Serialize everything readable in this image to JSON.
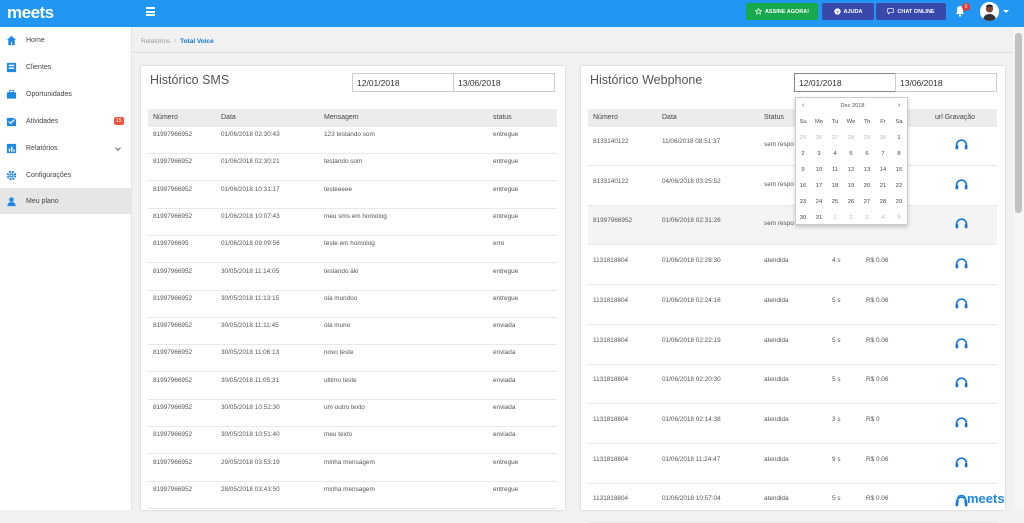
{
  "brand": {
    "logo": "meets",
    "watermark": "meets",
    "accent": "#2196f3"
  },
  "topbar": {
    "assine": "ASSINE AGORA!",
    "ajuda": "AJUDA",
    "chat": "CHAT ONLINE",
    "notif_count": "0"
  },
  "sidebar": {
    "items": [
      {
        "label": "Home",
        "icon": "home-icon"
      },
      {
        "label": "Clientes",
        "icon": "clients-icon"
      },
      {
        "label": "Oportunidades",
        "icon": "briefcase-icon"
      },
      {
        "label": "Atividades",
        "icon": "check-icon",
        "badge": "15"
      },
      {
        "label": "Relatórios",
        "icon": "chart-icon"
      },
      {
        "label": "Configurações",
        "icon": "gear-icon"
      },
      {
        "label": "Meu plano",
        "icon": "user-icon"
      }
    ]
  },
  "breadcrumb": {
    "parent": "Relatórios",
    "sep": "/",
    "current": "Total Voice"
  },
  "sms": {
    "title": "Histórico SMS",
    "date_from": "12/01/2018",
    "date_to": "13/06/2018",
    "columns": [
      "Número",
      "Data",
      "Mensagem",
      "status"
    ],
    "rows": [
      [
        "81997966952",
        "01/06/2018 02:30:43",
        "123 testando som",
        "entregue"
      ],
      [
        "81997966952",
        "01/06/2018 02:30:21",
        "testando som",
        "entregue"
      ],
      [
        "81997966952",
        "01/06/2018 10:31:17",
        "testeeeee",
        "entregue"
      ],
      [
        "81997966952",
        "01/06/2018 10:07:43",
        "meu sms em homolog",
        "entregue"
      ],
      [
        "8199796695",
        "01/06/2018 09:09:56",
        "teste em homolog",
        "erro"
      ],
      [
        "81997966952",
        "30/05/2018 11:14:05",
        "testando aki",
        "entregue"
      ],
      [
        "81997966952",
        "30/05/2018 11:13:15",
        "ola mundoo",
        "entregue"
      ],
      [
        "81997966952",
        "30/05/2018 11:11:45",
        "ola muno",
        "enviada"
      ],
      [
        "81997966952",
        "30/05/2018 11:06:13",
        "novo teste",
        "enviada"
      ],
      [
        "81997966952",
        "30/05/2018 11:05:31",
        "ultimo teste",
        "enviada"
      ],
      [
        "81997966952",
        "30/05/2018 10:52:30",
        "um outro texto",
        "enviada"
      ],
      [
        "81997966952",
        "30/05/2018 10:51:40",
        "meu texto",
        "enviada"
      ],
      [
        "81997966952",
        "29/05/2018 03:53:19",
        "minha mensagem",
        "entregue"
      ],
      [
        "81997966952",
        "28/05/2018 03:43:50",
        "minha mensagem",
        "entregue"
      ]
    ]
  },
  "webphone": {
    "title": "Histórico Webphone",
    "date_from": "12/01/2018",
    "date_to": "13/06/2018",
    "columns": [
      "Número",
      "Data",
      "Status",
      "",
      "",
      "url Gravação"
    ],
    "rows": [
      [
        "8133140122",
        "11/06/2018 08:51:37",
        "sem respo",
        "",
        ""
      ],
      [
        "8133140122",
        "04/06/2018 03:25:52",
        "sem respo",
        "",
        ""
      ],
      [
        "81997966952",
        "01/06/2018 02:31:26",
        "sem respo",
        "",
        ""
      ],
      [
        "1131818804",
        "01/06/2018 02:28:30",
        "atendida",
        "4 s",
        "R$ 0.06"
      ],
      [
        "1131818804",
        "01/06/2018 02:24:16",
        "atendida",
        "5 s",
        "R$ 0.06"
      ],
      [
        "1131818804",
        "01/06/2018 02:22:19",
        "atendida",
        "5 s",
        "R$ 0.06"
      ],
      [
        "1131818804",
        "01/06/2018 02:20:30",
        "atendida",
        "5 s",
        "R$ 0.06"
      ],
      [
        "1131818804",
        "01/06/2018 02:14:38",
        "atendida",
        "3 s",
        "R$ 0"
      ],
      [
        "1131818804",
        "01/06/2018 11:24:47",
        "atendida",
        "9 s",
        "R$ 0.06"
      ],
      [
        "1131818804",
        "01/06/2018 10:57:04",
        "atendida",
        "5 s",
        "R$ 0.06"
      ]
    ]
  },
  "calendar": {
    "month": "Dec 2018",
    "prev": "‹",
    "next": "›",
    "weekdays": [
      "Su",
      "Mo",
      "Tu",
      "We",
      "Th",
      "Fr",
      "Sa"
    ],
    "weeks": [
      [
        "25",
        "26",
        "27",
        "28",
        "29",
        "30",
        "1"
      ],
      [
        "2",
        "3",
        "4",
        "5",
        "6",
        "7",
        "8"
      ],
      [
        "9",
        "10",
        "11",
        "12",
        "13",
        "14",
        "15"
      ],
      [
        "16",
        "17",
        "18",
        "19",
        "20",
        "21",
        "22"
      ],
      [
        "23",
        "24",
        "25",
        "26",
        "27",
        "28",
        "29"
      ],
      [
        "30",
        "31",
        "1",
        "2",
        "3",
        "4",
        "5"
      ]
    ],
    "muted": [
      [
        0,
        0
      ],
      [
        0,
        1
      ],
      [
        0,
        2
      ],
      [
        0,
        3
      ],
      [
        0,
        4
      ],
      [
        0,
        5
      ],
      [
        5,
        2
      ],
      [
        5,
        3
      ],
      [
        5,
        4
      ],
      [
        5,
        5
      ],
      [
        5,
        6
      ]
    ]
  }
}
